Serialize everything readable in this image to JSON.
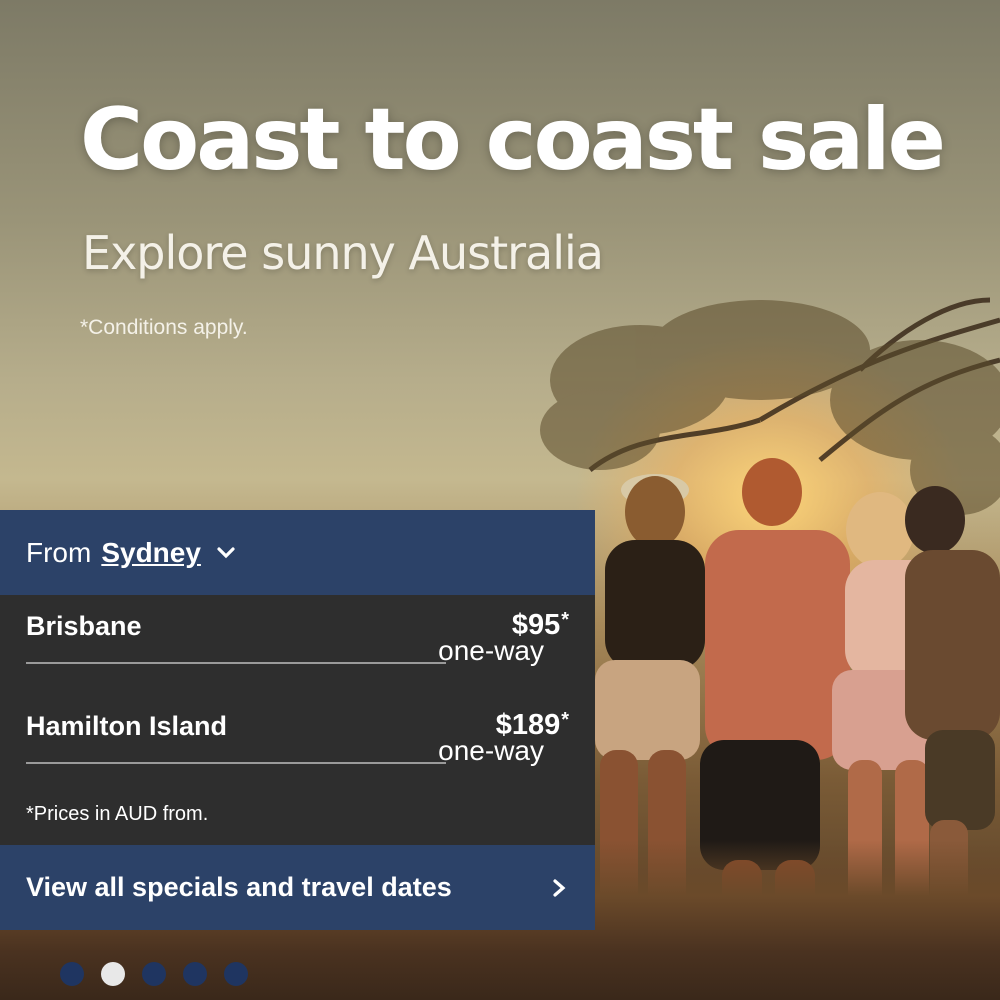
{
  "hero": {
    "headline": "Coast to coast sale",
    "subheadline": "Explore sunny Australia",
    "conditions": "*Conditions apply."
  },
  "origin": {
    "prefix": "From",
    "city": "Sydney",
    "icon": "chevron-down-icon"
  },
  "fares": [
    {
      "destination": "Brisbane",
      "price": "$95",
      "asterisk": "*",
      "type": "one-way"
    },
    {
      "destination": "Hamilton Island",
      "price": "$189",
      "asterisk": "*",
      "type": "one-way"
    }
  ],
  "footnote": "*Prices in AUD from.",
  "cta": {
    "label": "View all specials and travel dates",
    "icon": "chevron-right-icon"
  },
  "carousel": {
    "slide_count": 5,
    "active_index": 1
  },
  "colors": {
    "panel_blue": "#2c4268",
    "panel_dark": "#2e2e2e",
    "dot_inactive": "#1f3561",
    "dot_active": "#e8e8e8"
  }
}
